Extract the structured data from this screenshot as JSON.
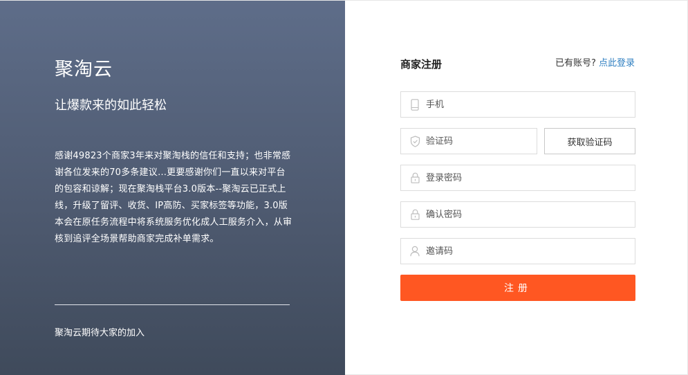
{
  "promo": {
    "brand": "聚淘云",
    "slogan": "让爆款来的如此轻松",
    "intro": "感谢49823个商家3年来对聚淘栈的信任和支持；也非常感谢各位发来的70多条建议…更要感谢你们一直以来对平台的包容和谅解；现在聚淘栈平台3.0版本--聚淘云已正式上线，升级了留评、收货、IP高防、买家标签等功能，3.0版本会在原任务流程中将系统服务优化成人工服务介入，从审核到追评全场景帮助商家完成补单需求。",
    "footer": "聚淘云期待大家的加入"
  },
  "form": {
    "title": "商家注册",
    "has_account_text": "已有账号?",
    "login_link": "点此登录",
    "phone_placeholder": "手机",
    "code_placeholder": "验证码",
    "get_code_label": "获取验证码",
    "password_placeholder": "登录密码",
    "confirm_password_placeholder": "确认密码",
    "invite_placeholder": "邀请码",
    "submit_label": "注册"
  },
  "icons": {
    "phone": "phone-icon",
    "code": "shield-icon",
    "password": "lock-icon",
    "confirm": "lock-icon",
    "invite": "user-icon"
  },
  "colors": {
    "panel_top": "#5e6d89",
    "panel_bottom": "#3f4a5b",
    "accent": "#ff5722",
    "link": "#2f7fc1"
  }
}
